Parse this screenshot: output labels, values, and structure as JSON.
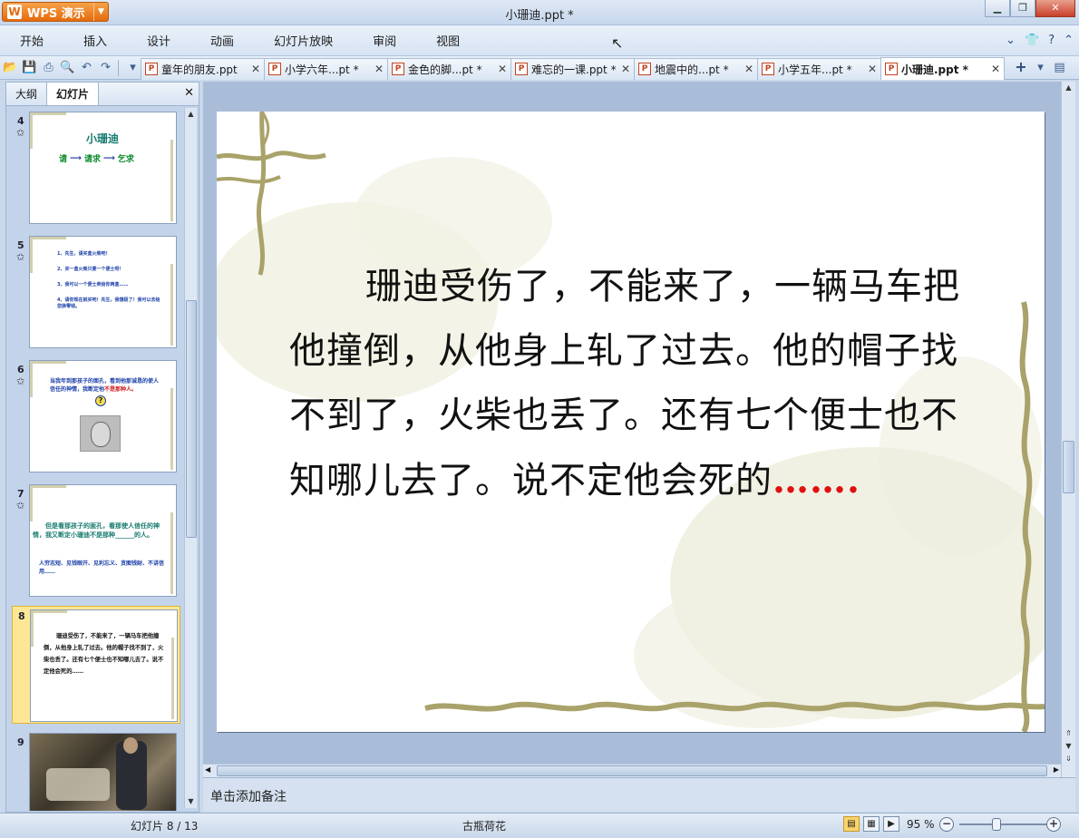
{
  "app": {
    "name": "WPS 演示",
    "window_title": "小珊迪.ppt *"
  },
  "menu": [
    "开始",
    "插入",
    "设计",
    "动画",
    "幻灯片放映",
    "审阅",
    "视图"
  ],
  "tabs": [
    {
      "label": "童年的朋友.ppt",
      "active": false
    },
    {
      "label": "小学六年...pt *",
      "active": false
    },
    {
      "label": "金色的脚...pt *",
      "active": false
    },
    {
      "label": "难忘的一课.ppt *",
      "active": false
    },
    {
      "label": "地震中的...pt *",
      "active": false
    },
    {
      "label": "小学五年...pt *",
      "active": false
    },
    {
      "label": "小珊迪.ppt *",
      "active": true
    }
  ],
  "left_panel": {
    "tab_outline": "大纲",
    "tab_slides": "幻灯片",
    "thumbnails": [
      {
        "num": "4",
        "title": "小珊迪",
        "flow": [
          "请",
          "请求",
          "乞求"
        ]
      },
      {
        "num": "5",
        "lines": [
          "1、先生，请买盒火柴吧！",
          "2、买一盒火柴只要一个便士呀！",
          "3、我可以一个便士卖给你两盒……",
          "4、请你现在就买吧！先生，我饿极了！我可以去给您换零钱。"
        ]
      },
      {
        "num": "6",
        "text_a": "当我年到那孩子的面孔，看到他那诚恳的使人信任的神情，我断定他",
        "text_b": "不是那种人。"
      },
      {
        "num": "7",
        "text_a": "但是看那孩子的面孔，看那使人信任的神情，我又断定小珊迪不是那种______的人。",
        "text_b": "人穷志短、见钱眼开、见利忘义、贪图钱财、不讲信用……"
      },
      {
        "num": "8",
        "text": "珊迪受伤了，不能来了，一辆马车把他撞倒，从他身上轧了过去。他的帽子找不到了，火柴也丢了。还有七个便士也不知哪儿去了。说不定他会死的……"
      },
      {
        "num": "9"
      }
    ]
  },
  "slide": {
    "body": "珊迪受伤了，不能来了，一辆马车把他撞倒，从他身上轧了过去。他的帽子找不到了，火柴也丢了。还有七个便士也不知哪儿去了。说不定他会死的",
    "ellipsis": "……."
  },
  "notes_placeholder": "单击添加备注",
  "status": {
    "slide_counter": "幻灯片 8 / 13",
    "theme": "古瓶荷花",
    "zoom": "95 %"
  }
}
